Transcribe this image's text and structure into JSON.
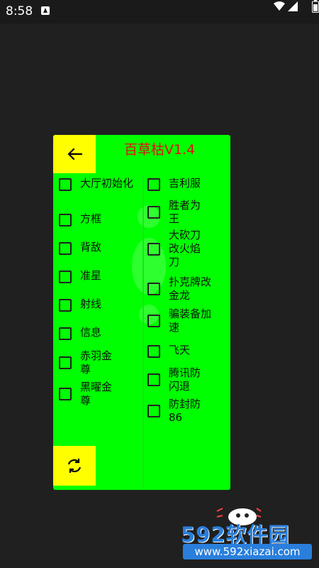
{
  "status_bar": {
    "time": "8:58",
    "icons": [
      "app-notification-icon",
      "wifi-icon",
      "signal-icon",
      "battery-icon"
    ]
  },
  "panel": {
    "title": "百草枯V1.4",
    "title_color": "#e01010",
    "background": "#00ff00",
    "accent": "#ffff00",
    "back_icon": "arrow-left-icon",
    "refresh_icon": "refresh-icon",
    "left_options": [
      {
        "label": "大厅初始化",
        "checked": false
      },
      {
        "label": "方框",
        "checked": false
      },
      {
        "label": "背敌",
        "checked": false
      },
      {
        "label": "准星",
        "checked": false
      },
      {
        "label": "射线",
        "checked": false
      },
      {
        "label": "信息",
        "checked": false
      },
      {
        "label": "赤羽金尊",
        "checked": false
      },
      {
        "label": "黑曜金尊",
        "checked": false
      }
    ],
    "right_options": [
      {
        "label": "吉利服",
        "checked": false
      },
      {
        "label": "胜者为王",
        "checked": false
      },
      {
        "label": "大砍刀改火焰刀",
        "checked": false
      },
      {
        "label": "扑克牌改金龙",
        "checked": false
      },
      {
        "label": "骗装备加速",
        "checked": false
      },
      {
        "label": "飞天",
        "checked": false
      },
      {
        "label": "腾讯防闪退",
        "checked": false
      },
      {
        "label": "防封防86",
        "checked": false
      }
    ]
  },
  "watermark": {
    "brand": "592软件园",
    "url": "www.592xiazai.com",
    "color": "#2a7fdc"
  }
}
